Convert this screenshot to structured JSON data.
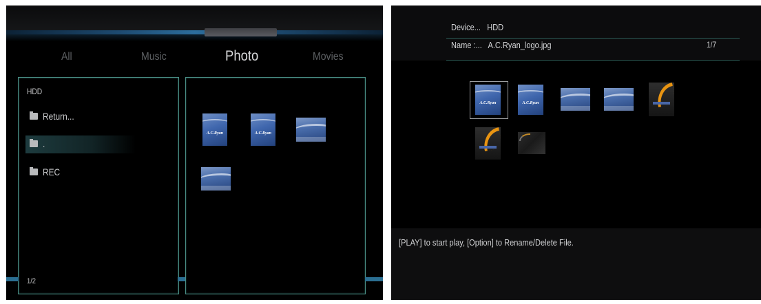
{
  "left_screen": {
    "tabs": [
      "All",
      "Music",
      "Photo",
      "Movies"
    ],
    "active_tab": "Photo",
    "file_panel": {
      "device": "HDD",
      "items": [
        {
          "label": "Return...",
          "icon": "folder-icon",
          "selected": false
        },
        {
          "label": ".",
          "icon": "folder-icon",
          "selected": true
        },
        {
          "label": "REC",
          "icon": "folder-icon",
          "selected": false
        }
      ],
      "page": "1/2"
    },
    "thumbnails": [
      {
        "text": "A.C.Ryan"
      },
      {
        "text": "A.C.Ryan"
      },
      {
        "text": ""
      },
      {
        "text": ""
      }
    ]
  },
  "right_screen": {
    "device_label": "Device...",
    "device_value": "HDD",
    "name_label": "Name :...",
    "name_value": "A.C.Ryan_logo.jpg",
    "counter": "1/7",
    "thumbnails": [
      {
        "text": "A.C.Ryan",
        "selected": true
      },
      {
        "text": "A.C.Ryan",
        "selected": false
      },
      {
        "text": "",
        "selected": false
      },
      {
        "text": "",
        "selected": false
      },
      {
        "text": "",
        "selected": false
      },
      {
        "text": "",
        "selected": false
      },
      {
        "text": "",
        "selected": false
      }
    ],
    "hint": "[PLAY] to start play, [Option] to Rename/Delete File."
  },
  "colors": {
    "panel_border": "#4a8f86",
    "accent_blue": "#2b6f92",
    "background": "#000000"
  }
}
